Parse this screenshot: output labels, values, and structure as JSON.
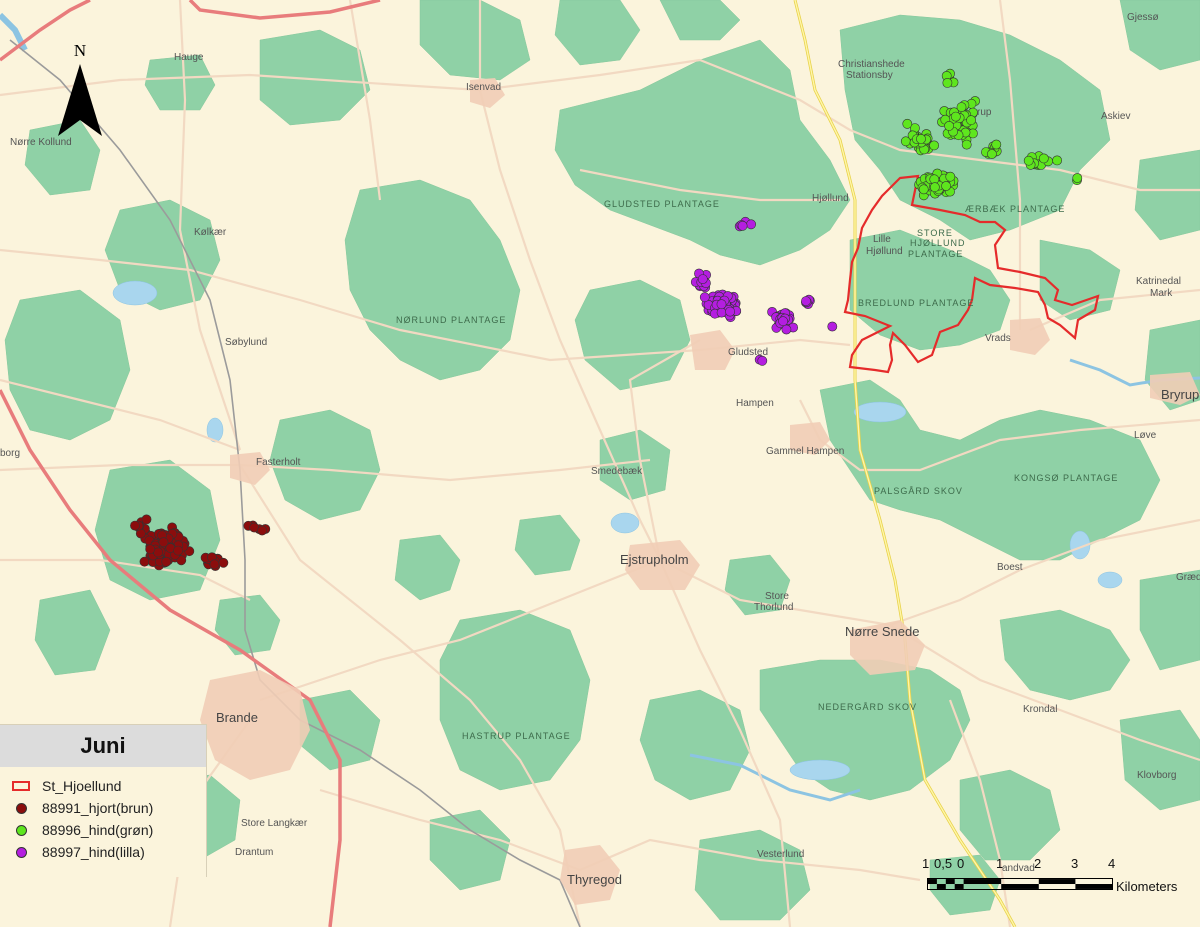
{
  "legend": {
    "title": "Juni",
    "items": [
      {
        "label": "St_Hjoellund",
        "kind": "outline",
        "color": "#e52b2b"
      },
      {
        "label": "88991_hjort(brun)",
        "kind": "dot",
        "color": "#8b0d0d"
      },
      {
        "label": "88996_hind(grøn)",
        "kind": "dot",
        "color": "#5ee61e"
      },
      {
        "label": "88997_hind(lilla)",
        "kind": "dot",
        "color": "#b41ee0"
      }
    ]
  },
  "north_label": "N",
  "scale": {
    "numbers": [
      "1",
      "0,5",
      "0",
      "1",
      "2",
      "3",
      "4"
    ],
    "unit": "Kilometers"
  },
  "places": {
    "hauge": "Hauge",
    "isenvad": "Isenvad",
    "norre_kollund": "Nørre Kollund",
    "kolkaer": "Kølkær",
    "sobylund": "Søbylund",
    "fasterholt": "Fasterholt",
    "borg": "borg",
    "brande": "Brande",
    "store_langkaer": "Store Langkær",
    "drantum": "Drantum",
    "thyregod": "Thyregod",
    "vesterlund": "Vesterlund",
    "ejstrupholm": "Ejstrupholm",
    "smedebaek": "Smedebæk",
    "store_thorlund_1": "Store",
    "store_thorlund_2": "Thorlund",
    "hampen": "Hampen",
    "gammel_hampen": "Gammel Hampen",
    "gludsted": "Gludsted",
    "lille_hjollund_1": "Lille",
    "lille_hjollund_2": "Hjøllund",
    "hjollund": "Hjøllund",
    "christianshede_1": "Christianshede",
    "christianshede_2": "Stationsby",
    "gjesso": "Gjessø",
    "askiev": "Askiev",
    "katrinedal_1": "Katrinedal",
    "katrinedal_2": "Mark",
    "vrads": "Vrads",
    "bryrup": "Bryrup",
    "love": "Løve",
    "boest": "Boest",
    "graed": "Græd",
    "norre_snede": "Nørre Snede",
    "krondal": "Krondal",
    "klovborg": "Klovborg",
    "trup": "rup",
    "landvad": "andvad"
  },
  "forests": {
    "gludsted_plantage": "GLUDSTED PLANTAGE",
    "norlund_plantage": "NØRLUND PLANTAGE",
    "store_hjollund_1": "STORE",
    "store_hjollund_2": "HJØLLUND",
    "store_hjollund_3": "PLANTAGE",
    "bredlund_plantage": "BREDLUND PLANTAGE",
    "palsgard_skov": "PALSGÅRD SKOV",
    "kongso_plantage": "KONGSØ PLANTAGE",
    "nedergard_skov": "NEDERGÅRD SKOV",
    "hastrup_plantage": "HASTRUP PLANTAGE",
    "aerbaek_plantage": "ÆRBÆK PLANTAGE"
  }
}
